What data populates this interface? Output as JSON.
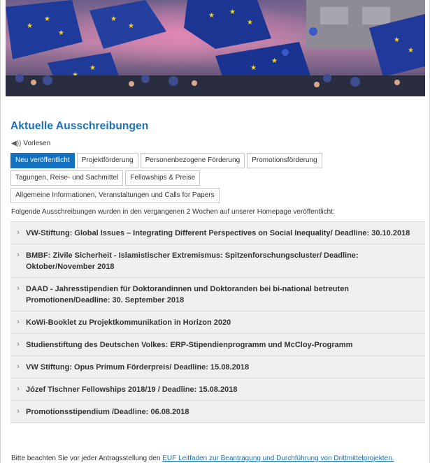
{
  "heading": "Aktuelle Ausschreibungen",
  "readaloud": {
    "icon": "speaker-icon",
    "label": "Vorlesen"
  },
  "tabs": [
    {
      "label": "Neu veröffentlicht",
      "active": true
    },
    {
      "label": "Projektförderung"
    },
    {
      "label": "Personenbezogene Förderung"
    },
    {
      "label": "Promotionsförderung"
    },
    {
      "label": "Tagungen, Reise- und Sachmittel"
    },
    {
      "label": "Fellowships & Preise"
    },
    {
      "label": "Allgemeine Informationen, Veranstaltungen und Calls for Papers"
    }
  ],
  "intro": "Folgende Ausschreibungen wurden in den vergangenen 2 Wochen auf unserer Homepage veröffentlicht:",
  "items": [
    {
      "title": "VW-Stiftung: Global Issues – Integrating Different Perspectives on Social Inequality/ Deadline: 30.10.2018"
    },
    {
      "title": "BMBF: Zivile Sicherheit - Islamistischer Extremismus: Spitzenforschungscluster/ Deadline: Oktober/November 2018"
    },
    {
      "title": "DAAD - Jahresstipendien für Doktorandinnen und Doktoranden bei bi-national betreuten Promotionen/Deadline: 30. September 2018"
    },
    {
      "title": "KoWi-Booklet zu Projektkommunikation in Horizon 2020"
    },
    {
      "title": "Studienstiftung des Deutschen Volkes: ERP-Stipendienprogramm und McCloy-Programm"
    },
    {
      "title": "VW Stiftung: Opus Primum Förderpreis/ Deadline: 15.08.2018"
    },
    {
      "title": "Józef Tischner Fellowships 2018/19 / Deadline: 15.08.2018"
    },
    {
      "title": "Promotionsstipendium /Deadline: 06.08.2018"
    }
  ],
  "chevron": "›",
  "footer": {
    "prefix": "Bitte beachten Sie vor jeder Antragsstellung den ",
    "link": "EUF Leitfaden zur Beantragung und Durchführung von Drittmittelprojekten."
  },
  "colors": {
    "accent": "#1471bf",
    "heading": "#1b6fb5",
    "item_bg": "#efefef"
  }
}
